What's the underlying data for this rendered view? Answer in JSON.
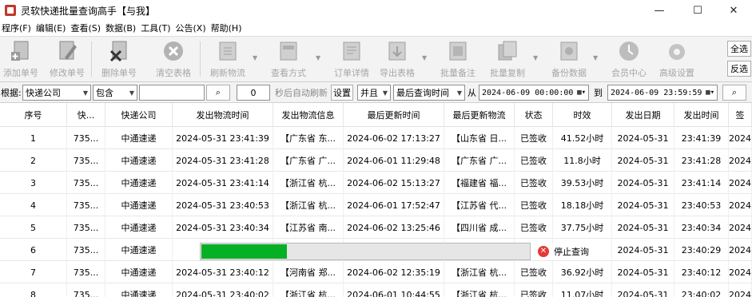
{
  "window": {
    "title": "灵软快递批量查询高手【与我】"
  },
  "window_controls": {
    "minimize": "—",
    "maximize": "☐",
    "close": "✕"
  },
  "menu": [
    "程序(F)",
    "编辑(E)",
    "查看(S)",
    "数据(B)",
    "工具(T)",
    "公告(X)",
    "帮助(H)"
  ],
  "toolbar": {
    "buttons": [
      {
        "label": "添加单号",
        "icon": "add-document-icon"
      },
      {
        "label": "修改单号",
        "icon": "edit-document-icon"
      },
      {
        "label": "删除单号",
        "icon": "delete-document-icon"
      },
      {
        "label": "清空表格",
        "icon": "clear-table-icon"
      },
      {
        "label": "刷新物流",
        "icon": "refresh-icon"
      },
      {
        "label": "查看方式",
        "icon": "view-mode-icon"
      },
      {
        "label": "订单详情",
        "icon": "order-details-icon"
      },
      {
        "label": "导出表格",
        "icon": "export-table-icon"
      },
      {
        "label": "批量备注",
        "icon": "batch-note-icon"
      },
      {
        "label": "批量复制",
        "icon": "batch-copy-icon"
      },
      {
        "label": "备份数据",
        "icon": "backup-icon"
      },
      {
        "label": "会员中心",
        "icon": "member-center-icon"
      },
      {
        "label": "高级设置",
        "icon": "advanced-settings-icon"
      }
    ],
    "select_all": "全选",
    "invert_select": "反选"
  },
  "filter": {
    "label": "根据:",
    "field": "快递公司",
    "operator": "包含",
    "keyword": "",
    "search_icon": "search-icon",
    "refresh_seconds": "0",
    "auto_refresh_label": "秒后自动刷新",
    "settings_button": "设置",
    "logic": "并且",
    "time_field": "最后查询时间",
    "from_label": "从",
    "from_date": "2024-06-09 00:00:00",
    "to_label": "到",
    "to_date": "2024-06-09 23:59:59"
  },
  "table": {
    "columns": [
      "序号",
      "快...",
      "快递公司",
      "发出物流时间",
      "发出物流信息",
      "最后更新时间",
      "最后更新物流",
      "状态",
      "时效",
      "发出日期",
      "发出时间",
      "签"
    ],
    "rows": [
      [
        "1",
        "735...",
        "中通速递",
        "2024-05-31 23:41:39",
        "【广东省 东...",
        "2024-06-02 17:13:27",
        "【山东省 日...",
        "已签收",
        "41.52小时",
        "2024-05-31",
        "23:41:39",
        "2024"
      ],
      [
        "2",
        "735...",
        "中通速递",
        "2024-05-31 23:41:28",
        "【广东省 广...",
        "2024-06-01 11:29:48",
        "【广东省 广...",
        "已签收",
        "11.8小时",
        "2024-05-31",
        "23:41:28",
        "2024"
      ],
      [
        "3",
        "735...",
        "中通速递",
        "2024-05-31 23:41:14",
        "【浙江省 杭...",
        "2024-06-02 15:13:27",
        "【福建省 福...",
        "已签收",
        "39.53小时",
        "2024-05-31",
        "23:41:14",
        "2024"
      ],
      [
        "4",
        "735...",
        "中通速递",
        "2024-05-31 23:40:53",
        "【浙江省 杭...",
        "2024-06-01 17:52:47",
        "【江苏省 代...",
        "已签收",
        "18.18小时",
        "2024-05-31",
        "23:40:53",
        "2024"
      ],
      [
        "5",
        "735...",
        "中通速递",
        "2024-05-31 23:40:34",
        "【江苏省 南...",
        "2024-06-02 13:25:46",
        "【四川省 成...",
        "已签收",
        "37.75小时",
        "2024-05-31",
        "23:40:34",
        "2024"
      ],
      [
        "6",
        "735...",
        "中通速递",
        "2024",
        "",
        "",
        "",
        "",
        "",
        "2024-05-31",
        "23:40:29",
        "2024"
      ],
      [
        "7",
        "735...",
        "中通速递",
        "2024-05-31 23:40:12",
        "【河南省 郑...",
        "2024-06-02 12:35:19",
        "【浙江省 杭...",
        "已签收",
        "36.92小时",
        "2024-05-31",
        "23:40:12",
        "2024"
      ],
      [
        "8",
        "735...",
        "中通速递",
        "2024-05-31 23:40:02",
        "【浙江省 杭...",
        "2024-06-01 10:44:55",
        "【浙江省 杭...",
        "已签收",
        "11.07小时",
        "2024-05-31",
        "23:40:02",
        "2024"
      ]
    ]
  },
  "progress": {
    "fraction": 0.26,
    "stop_label": "停止查询",
    "fill_color": "#06b025"
  }
}
